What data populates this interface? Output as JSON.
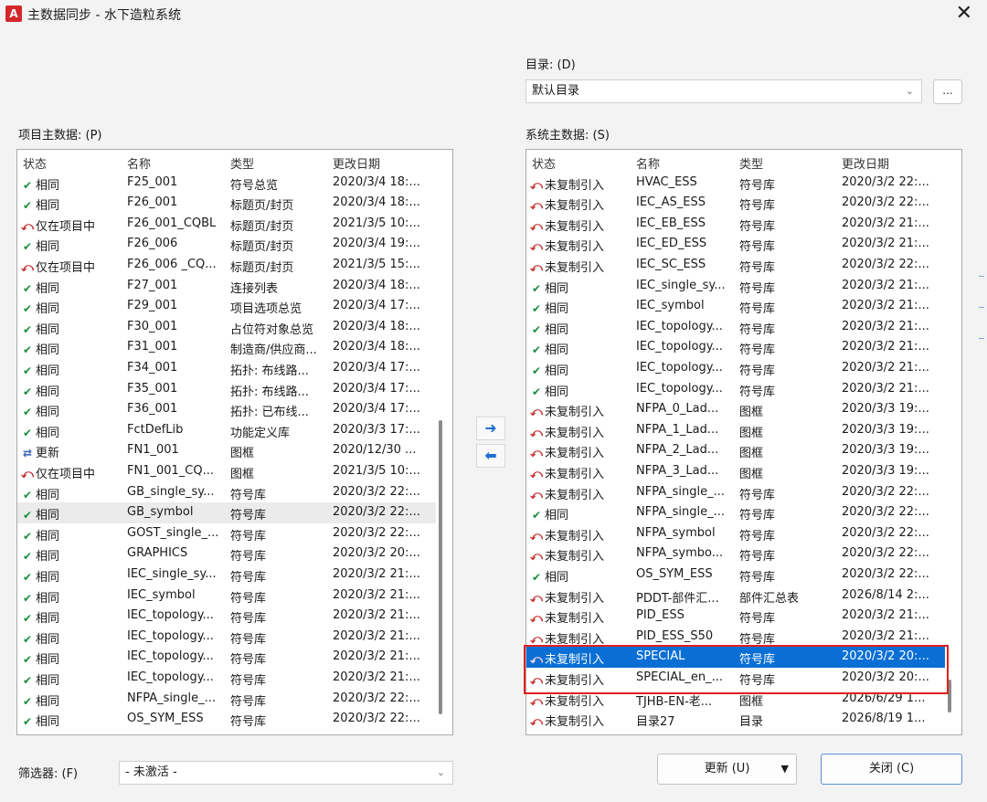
{
  "window": {
    "title": "主数据同步 - 水下造粒系统",
    "app_icon_glyph": "Α",
    "close_glyph": "✕"
  },
  "directory": {
    "label": "目录: (D)",
    "value": "默认目录",
    "browse_label": "..."
  },
  "project": {
    "label": "项目主数据: (P)",
    "columns": [
      "状态",
      "名称",
      "类型",
      "更改日期"
    ],
    "rows": [
      {
        "icon": "check-icon",
        "status": "相同",
        "name": "F25_001",
        "type": "符号总览",
        "date": "2020/3/4 18:..."
      },
      {
        "icon": "check-icon",
        "status": "相同",
        "name": "F26_001",
        "type": "标题页/封页",
        "date": "2020/3/4 18:..."
      },
      {
        "icon": "diff-icon",
        "status": "仅在项目中",
        "name": "F26_001_CQBL",
        "type": "标题页/封页",
        "date": "2021/3/5 10:..."
      },
      {
        "icon": "check-icon",
        "status": "相同",
        "name": "F26_006",
        "type": "标题页/封页",
        "date": "2020/3/4 19:..."
      },
      {
        "icon": "diff-icon",
        "status": "仅在项目中",
        "name": "F26_006 _CQ...",
        "type": "标题页/封页",
        "date": "2021/3/5 15:..."
      },
      {
        "icon": "check-icon",
        "status": "相同",
        "name": "F27_001",
        "type": "连接列表",
        "date": "2020/3/4 18:..."
      },
      {
        "icon": "check-icon",
        "status": "相同",
        "name": "F29_001",
        "type": "项目选项总览",
        "date": "2020/3/4 17:..."
      },
      {
        "icon": "check-icon",
        "status": "相同",
        "name": "F30_001",
        "type": "占位符对象总览",
        "date": "2020/3/4 18:..."
      },
      {
        "icon": "check-icon",
        "status": "相同",
        "name": "F31_001",
        "type": "制造商/供应商...",
        "date": "2020/3/4 18:..."
      },
      {
        "icon": "check-icon",
        "status": "相同",
        "name": "F34_001",
        "type": "拓扑: 布线路...",
        "date": "2020/3/4 17:..."
      },
      {
        "icon": "check-icon",
        "status": "相同",
        "name": "F35_001",
        "type": "拓扑: 布线路...",
        "date": "2020/3/4 17:..."
      },
      {
        "icon": "check-icon",
        "status": "相同",
        "name": "F36_001",
        "type": "拓扑: 已布线...",
        "date": "2020/3/4 17:..."
      },
      {
        "icon": "check-icon",
        "status": "相同",
        "name": "FctDefLib",
        "type": "功能定义库",
        "date": "2020/3/3 17:..."
      },
      {
        "icon": "update-icon",
        "status": "更新",
        "name": "FN1_001",
        "type": "图框",
        "date": "2020/12/30 ..."
      },
      {
        "icon": "diff-icon",
        "status": "仅在项目中",
        "name": "FN1_001_CQ...",
        "type": "图框",
        "date": "2021/3/5 10:..."
      },
      {
        "icon": "check-icon",
        "status": "相同",
        "name": "GB_single_sy...",
        "type": "符号库",
        "date": "2020/3/2 22:..."
      },
      {
        "icon": "check-icon",
        "status": "相同",
        "name": "GB_symbol",
        "type": "符号库",
        "date": "2020/3/2 22:...",
        "highlight": true
      },
      {
        "icon": "check-icon",
        "status": "相同",
        "name": "GOST_single_...",
        "type": "符号库",
        "date": "2020/3/2 22:..."
      },
      {
        "icon": "check-icon",
        "status": "相同",
        "name": "GRAPHICS",
        "type": "符号库",
        "date": "2020/3/2 20:..."
      },
      {
        "icon": "check-icon",
        "status": "相同",
        "name": "IEC_single_sy...",
        "type": "符号库",
        "date": "2020/3/2 21:..."
      },
      {
        "icon": "check-icon",
        "status": "相同",
        "name": "IEC_symbol",
        "type": "符号库",
        "date": "2020/3/2 21:..."
      },
      {
        "icon": "check-icon",
        "status": "相同",
        "name": "IEC_topology...",
        "type": "符号库",
        "date": "2020/3/2 21:..."
      },
      {
        "icon": "check-icon",
        "status": "相同",
        "name": "IEC_topology...",
        "type": "符号库",
        "date": "2020/3/2 21:..."
      },
      {
        "icon": "check-icon",
        "status": "相同",
        "name": "IEC_topology...",
        "type": "符号库",
        "date": "2020/3/2 21:..."
      },
      {
        "icon": "check-icon",
        "status": "相同",
        "name": "IEC_topology...",
        "type": "符号库",
        "date": "2020/3/2 21:..."
      },
      {
        "icon": "check-icon",
        "status": "相同",
        "name": "NFPA_single_...",
        "type": "符号库",
        "date": "2020/3/2 22:..."
      },
      {
        "icon": "check-icon",
        "status": "相同",
        "name": "OS_SYM_ESS",
        "type": "符号库",
        "date": "2020/3/2 22:..."
      }
    ]
  },
  "system": {
    "label": "系统主数据: (S)",
    "columns": [
      "状态",
      "名称",
      "类型",
      "更改日期"
    ],
    "rows": [
      {
        "icon": "diff-icon",
        "status": "未复制引入",
        "name": "HVAC_ESS",
        "type": "符号库",
        "date": "2020/3/2 22:..."
      },
      {
        "icon": "diff-icon",
        "status": "未复制引入",
        "name": "IEC_AS_ESS",
        "type": "符号库",
        "date": "2020/3/2 22:..."
      },
      {
        "icon": "diff-icon",
        "status": "未复制引入",
        "name": "IEC_EB_ESS",
        "type": "符号库",
        "date": "2020/3/2 21:..."
      },
      {
        "icon": "diff-icon",
        "status": "未复制引入",
        "name": "IEC_ED_ESS",
        "type": "符号库",
        "date": "2020/3/2 21:..."
      },
      {
        "icon": "diff-icon",
        "status": "未复制引入",
        "name": "IEC_SC_ESS",
        "type": "符号库",
        "date": "2020/3/2 22:..."
      },
      {
        "icon": "check-icon",
        "status": "相同",
        "name": "IEC_single_sy...",
        "type": "符号库",
        "date": "2020/3/2 21:..."
      },
      {
        "icon": "check-icon",
        "status": "相同",
        "name": "IEC_symbol",
        "type": "符号库",
        "date": "2020/3/2 21:..."
      },
      {
        "icon": "check-icon",
        "status": "相同",
        "name": "IEC_topology...",
        "type": "符号库",
        "date": "2020/3/2 21:..."
      },
      {
        "icon": "check-icon",
        "status": "相同",
        "name": "IEC_topology...",
        "type": "符号库",
        "date": "2020/3/2 21:..."
      },
      {
        "icon": "check-icon",
        "status": "相同",
        "name": "IEC_topology...",
        "type": "符号库",
        "date": "2020/3/2 21:..."
      },
      {
        "icon": "check-icon",
        "status": "相同",
        "name": "IEC_topology...",
        "type": "符号库",
        "date": "2020/3/2 21:..."
      },
      {
        "icon": "diff-icon",
        "status": "未复制引入",
        "name": "NFPA_0_Lad...",
        "type": "图框",
        "date": "2020/3/3 19:..."
      },
      {
        "icon": "diff-icon",
        "status": "未复制引入",
        "name": "NFPA_1_Lad...",
        "type": "图框",
        "date": "2020/3/3 19:..."
      },
      {
        "icon": "diff-icon",
        "status": "未复制引入",
        "name": "NFPA_2_Lad...",
        "type": "图框",
        "date": "2020/3/3 19:..."
      },
      {
        "icon": "diff-icon",
        "status": "未复制引入",
        "name": "NFPA_3_Lad...",
        "type": "图框",
        "date": "2020/3/3 19:..."
      },
      {
        "icon": "diff-icon",
        "status": "未复制引入",
        "name": "NFPA_single_...",
        "type": "符号库",
        "date": "2020/3/2 22:..."
      },
      {
        "icon": "check-icon",
        "status": "相同",
        "name": "NFPA_single_...",
        "type": "符号库",
        "date": "2020/3/2 22:..."
      },
      {
        "icon": "diff-icon",
        "status": "未复制引入",
        "name": "NFPA_symbol",
        "type": "符号库",
        "date": "2020/3/2 22:..."
      },
      {
        "icon": "diff-icon",
        "status": "未复制引入",
        "name": "NFPA_symbo...",
        "type": "符号库",
        "date": "2020/3/2 22:..."
      },
      {
        "icon": "check-icon",
        "status": "相同",
        "name": "OS_SYM_ESS",
        "type": "符号库",
        "date": "2020/3/2 22:..."
      },
      {
        "icon": "diff-icon",
        "status": "未复制引入",
        "name": "PDDT-部件汇...",
        "type": "部件汇总表",
        "date": "2026/8/14 2:..."
      },
      {
        "icon": "diff-icon",
        "status": "未复制引入",
        "name": "PID_ESS",
        "type": "符号库",
        "date": "2020/3/2 21:..."
      },
      {
        "icon": "diff-icon",
        "status": "未复制引入",
        "name": "PID_ESS_S50",
        "type": "符号库",
        "date": "2020/3/2 21:..."
      },
      {
        "icon": "diff-icon",
        "status": "未复制引入",
        "name": "SPECIAL",
        "type": "符号库",
        "date": "2020/3/2 20:...",
        "selected": true
      },
      {
        "icon": "diff-icon",
        "status": "未复制引入",
        "name": "SPECIAL_en_...",
        "type": "符号库",
        "date": "2020/3/2 20:..."
      },
      {
        "icon": "diff-icon",
        "status": "未复制引入",
        "name": "TJHB-EN-老...",
        "type": "图框",
        "date": "2026/6/29 1..."
      },
      {
        "icon": "diff-icon",
        "status": "未复制引入",
        "name": "目录27",
        "type": "目录",
        "date": "2026/8/19 1..."
      }
    ]
  },
  "transfer": {
    "right_arrow": "➜",
    "left_arrow": "⬅"
  },
  "filter": {
    "label": "筛选器: (F)",
    "value": "- 未激活 -"
  },
  "buttons": {
    "update_label": "更新 (U)",
    "close_label": "关闭 (C)"
  },
  "colors": {
    "accent": "#0a6fd4",
    "check": "#1b8e3e",
    "diff": "#c62828",
    "highlight_box": "#e02020"
  }
}
